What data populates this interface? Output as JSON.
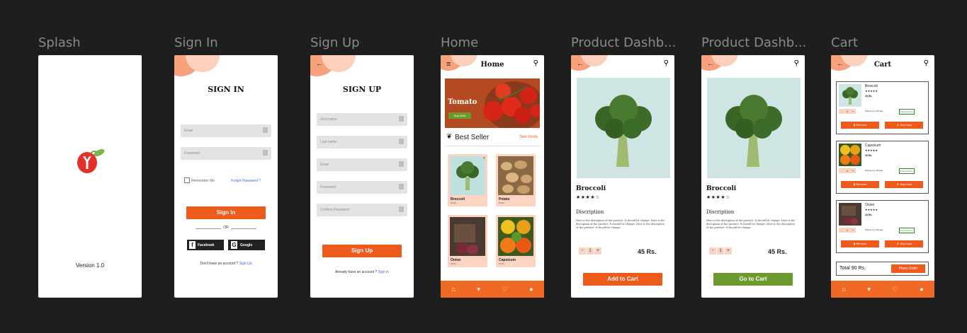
{
  "frames": [
    {
      "label": "Splash"
    },
    {
      "label": "Sign In"
    },
    {
      "label": "Sign Up"
    },
    {
      "label": "Home"
    },
    {
      "label": "Product Dashb..."
    },
    {
      "label": "Product Dashb..."
    },
    {
      "label": "Cart"
    }
  ],
  "splash": {
    "version": "Version 1.0"
  },
  "signin": {
    "title": "SIGN IN",
    "email_placeholder": "Email",
    "password_placeholder": "Password",
    "remember": "Remember Me",
    "forgot": "Forgot Password ?",
    "button": "Sign In",
    "or": "OR",
    "facebook": "Facebook",
    "google": "Google",
    "no_account": "Don't have an account ?",
    "signup_link": "Sign Up"
  },
  "signup": {
    "title": "SIGN UP",
    "firstname": "First name",
    "lastname": "Last name",
    "email": "Email",
    "password": "Password",
    "confirm": "Confirm Password",
    "button": "Sign Up",
    "have_account": "Already have an account ?",
    "signin_link": "Sign in"
  },
  "home": {
    "title": "Home",
    "banner_title": "Tomato",
    "banner_button": "Buy Now",
    "section_title": "Best Seller",
    "see_more": "See more",
    "products": [
      {
        "name": "Broccoli",
        "price": "45 Rs."
      },
      {
        "name": "Potato",
        "price": "30 Rs."
      },
      {
        "name": "Onion",
        "price": "34 Rs."
      },
      {
        "name": "Capsicum",
        "price": "27 Rs."
      }
    ]
  },
  "product": {
    "name": "Broccoli",
    "stars": "★★★★☆",
    "description_heading": "Discription",
    "description": "Here is the discription of the product. It should be change. Here is the discription of the product. It should be change. Here is the discription of the product. It should be change.",
    "qty_minus": "-",
    "qty_value": "1",
    "qty_plus": "+",
    "price": "45 Rs.",
    "add_to_cart": "Add to Cart",
    "go_to_cart": "Go to Cart"
  },
  "cart": {
    "title": "Cart",
    "items": [
      {
        "name": "Broccoli",
        "stars": "★★★★★",
        "price": "45 Rs.",
        "qty": "1",
        "delivery": "Delivery by 18 Sep",
        "free": "Free Delivery",
        "remove": "Remove",
        "buy": "Buy Now"
      },
      {
        "name": "Capsicum",
        "stars": "★★★★★",
        "price": "30 Rs.",
        "qty": "1",
        "delivery": "Delivery by 18 Sep",
        "free": "Free Delivery",
        "remove": "Remove",
        "buy": "Buy Now"
      },
      {
        "name": "Onion",
        "stars": "★★★★★",
        "price": "34 Rs.",
        "qty": "1",
        "delivery": "Delivery by 18 Sep",
        "free": "Free Delivery",
        "remove": "Remove",
        "buy": "Buy Now"
      }
    ],
    "total": "Total 90 Rs.",
    "place_order": "Place Order"
  },
  "colors": {
    "accent": "#ee5a1c",
    "peach": "#fbd4c3",
    "green": "#6d9a2f",
    "canvas": "#1e1e1e"
  }
}
